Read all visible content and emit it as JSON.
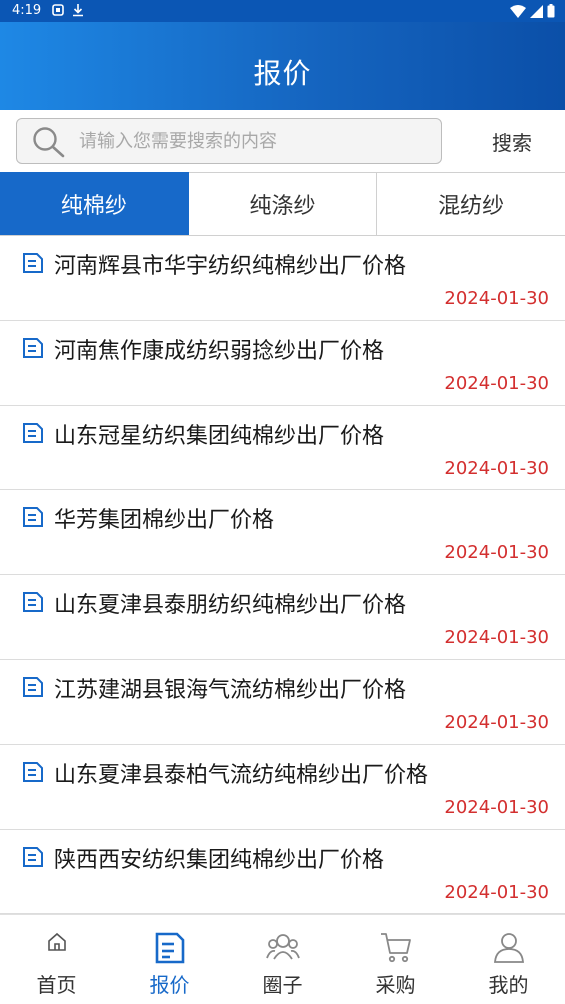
{
  "status_bar": {
    "time": "4:19"
  },
  "header": {
    "title": "报价"
  },
  "search": {
    "placeholder": "请输入您需要搜索的内容",
    "value": "",
    "button_label": "搜索"
  },
  "tabs": [
    {
      "label": "纯棉纱",
      "active": true
    },
    {
      "label": "纯涤纱",
      "active": false
    },
    {
      "label": "混纺纱",
      "active": false
    }
  ],
  "items": [
    {
      "title": "河南辉县市华宇纺织纯棉纱出厂价格",
      "date": "2024-01-30"
    },
    {
      "title": "河南焦作康成纺织弱捻纱出厂价格",
      "date": "2024-01-30"
    },
    {
      "title": "山东冠星纺织集团纯棉纱出厂价格",
      "date": "2024-01-30"
    },
    {
      "title": "华芳集团棉纱出厂价格",
      "date": "2024-01-30"
    },
    {
      "title": "山东夏津县泰朋纺织纯棉纱出厂价格",
      "date": "2024-01-30"
    },
    {
      "title": "江苏建湖县银海气流纺棉纱出厂价格",
      "date": "2024-01-30"
    },
    {
      "title": "山东夏津县泰柏气流纺纯棉纱出厂价格",
      "date": "2024-01-30"
    },
    {
      "title": "陕西西安纺织集团纯棉纱出厂价格",
      "date": "2024-01-30"
    }
  ],
  "bottom_nav": [
    {
      "label": "首页",
      "icon": "home-icon",
      "active": false
    },
    {
      "label": "报价",
      "icon": "quote-icon",
      "active": true
    },
    {
      "label": "圈子",
      "icon": "community-icon",
      "active": false
    },
    {
      "label": "采购",
      "icon": "cart-icon",
      "active": false
    },
    {
      "label": "我的",
      "icon": "profile-icon",
      "active": false
    }
  ],
  "colors": {
    "primary": "#1769c9",
    "date": "#d32f2f",
    "header_start": "#1e88e5",
    "header_end": "#0b4fa8"
  }
}
